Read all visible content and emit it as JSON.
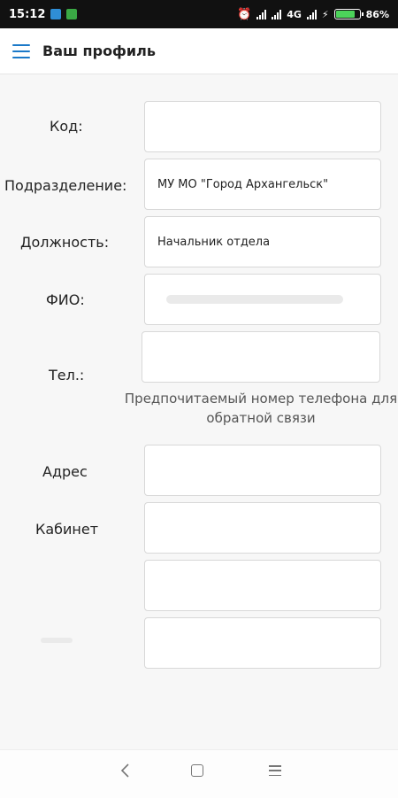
{
  "status_bar": {
    "time": "15:12",
    "network": "4G",
    "battery": "86%",
    "battery_level": 0.86
  },
  "app_bar": {
    "title": "Ваш профиль",
    "menu_icon": "hamburger-menu-icon"
  },
  "form": {
    "code": {
      "label": "Код:",
      "value": ""
    },
    "department": {
      "label": "Подразделение:",
      "value": "МУ МО \"Город Архангельск\" "
    },
    "position": {
      "label": "Должность:",
      "value": "Начальник отдела"
    },
    "fio": {
      "label": "ФИО:",
      "value": ""
    },
    "phone": {
      "label": "Тел.:",
      "value": "",
      "hint": "Предпочитаемый номер телефона для обратной связи"
    },
    "address": {
      "label": "Адрес",
      "value": ""
    },
    "office": {
      "label": "Кабинет",
      "value": ""
    },
    "extra1": {
      "label": "",
      "value": ""
    },
    "extra2": {
      "label": "",
      "value": ""
    }
  },
  "nav": {
    "back_icon": "back-icon",
    "home_icon": "home-icon",
    "recent_icon": "recent-apps-icon"
  }
}
